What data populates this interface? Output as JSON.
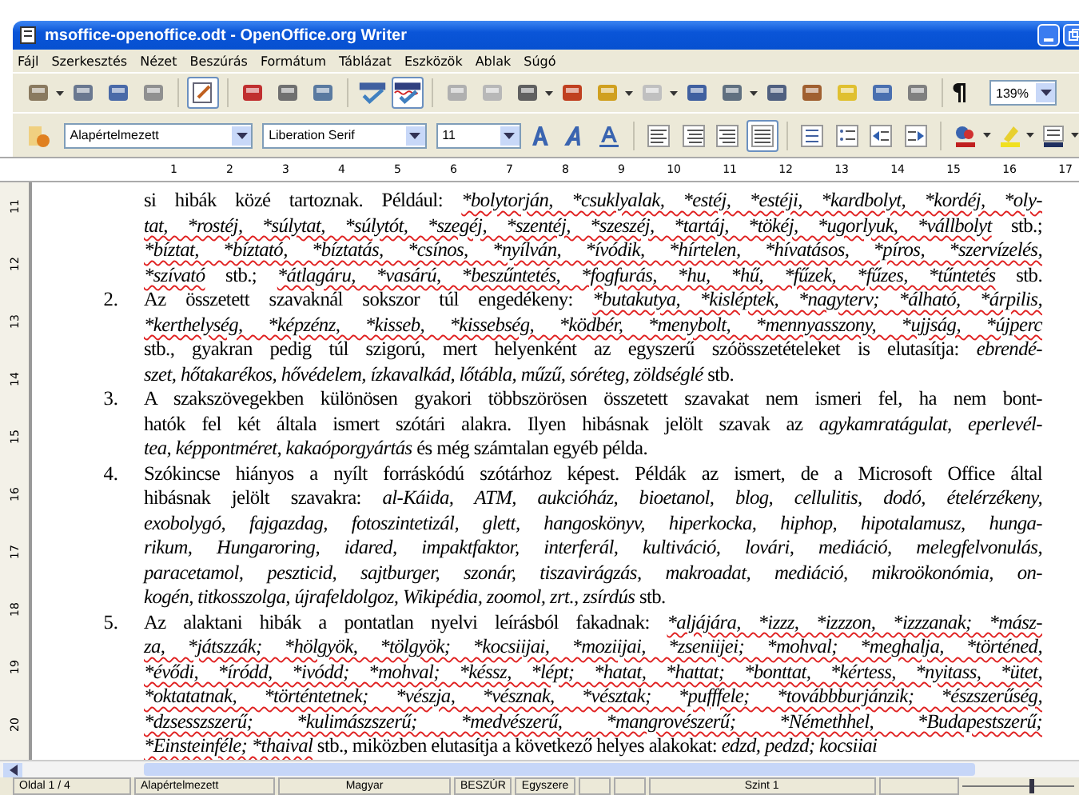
{
  "window": {
    "title": "msoffice-openoffice.odt - OpenOffice.org Writer"
  },
  "menu": [
    "Fájl",
    "Szerkesztés",
    "Nézet",
    "Beszúrás",
    "Formátum",
    "Táblázat",
    "Eszközök",
    "Ablak",
    "Súgó"
  ],
  "standard_toolbar": {
    "edit_mode_on": true,
    "auto_spellcheck_on": true,
    "zoom": "139%"
  },
  "formatting_toolbar": {
    "paragraph_style": "Alapértelmezett",
    "font": "Liberation Serif",
    "size": "11",
    "alignment": [
      {
        "selected": false
      },
      {
        "selected": false
      },
      {
        "selected": false
      },
      {
        "selected": true
      }
    ]
  },
  "ruler": {
    "marks": [
      "1",
      "2",
      "3",
      "4",
      "5",
      "6",
      "7",
      "8",
      "9",
      "10",
      "11",
      "12",
      "13",
      "14",
      "15",
      "16",
      "17"
    ]
  },
  "vertical_ruler": {
    "marks": [
      "11",
      "12",
      "13",
      "14",
      "15",
      "16",
      "17",
      "18",
      "19",
      "20"
    ]
  },
  "document": {
    "items": [
      {
        "lines": [
          [
            {
              "text": "si hibák közé tartoznak. Például: ",
              "kind": "plain"
            },
            {
              "text": "*bolytorján, *csuklyalak, *estéj, *estéji, *kardbolyt, *kordéj, *oly-",
              "kind": "flagged"
            }
          ],
          [
            {
              "text": "tat, *rostéj, *súlytat, *súlytót, *szegéj, *szentéj, *szeszéj, *tartáj, *tökéj, *ugorlyuk, *vállbolyt",
              "kind": "flagged"
            },
            {
              "text": " stb.;",
              "kind": "plain"
            }
          ],
          [
            {
              "text": "*bíztat, *bíztató, *bíztatás, *csínos, *nyílván, *ívódik, *hírtelen, *hívatásos, *píros, *szervízelés,",
              "kind": "flagged"
            }
          ],
          [
            {
              "text": "*szívató",
              "kind": "flagged"
            },
            {
              "text": " stb.; ",
              "kind": "plain"
            },
            {
              "text": "*átlagáru, *vasárú, *beszűntetés, *fogfurás, *hu, *hű, *fűzek, *fűzes, *tűntetés",
              "kind": "flagged"
            },
            {
              "text": " stb.",
              "kind": "plain"
            }
          ]
        ]
      },
      {
        "number": "2.",
        "lines": [
          [
            {
              "text": "Az összetett szavaknál sokszor túl engedékeny: ",
              "kind": "plain"
            },
            {
              "text": "*butakutya, *kisléptek, *nagyterv; *álható, *árpilis,",
              "kind": "flagged"
            }
          ],
          [
            {
              "text": "*kerthelység, *képzénz, *kisseb, *kissebség, *ködbér, *menybolt, *mennyasszony, *ujjság, *újperc",
              "kind": "flagged"
            }
          ],
          [
            {
              "text": "stb., gyakran pedig túl szigorú, mert helyenként az egyszerű szóösszetételeket is elutasítja: ",
              "kind": "plain"
            },
            {
              "text": "ebrendé-",
              "kind": "italic"
            }
          ],
          [
            {
              "text": "szet, hőtakarékos, hővédelem, ízkavalkád, lőtábla, műzű, sóréteg, zöldséglé",
              "kind": "italic"
            },
            {
              "text": " stb.",
              "kind": "plain"
            }
          ]
        ]
      },
      {
        "number": "3.",
        "lines": [
          [
            {
              "text": "A szakszövegekben különösen gyakori többszörösen összetett szavakat nem ismeri fel, ha nem bont-",
              "kind": "plain"
            }
          ],
          [
            {
              "text": "hatók fel két általa ismert szótári alakra. Ilyen hibásnak jelölt szavak az ",
              "kind": "plain"
            },
            {
              "text": "agykamratágulat, eperlevél-",
              "kind": "italic"
            }
          ],
          [
            {
              "text": "tea, képpontméret, kakaóporgyártás",
              "kind": "italic"
            },
            {
              "text": " és még számtalan egyéb példa.",
              "kind": "plain"
            }
          ]
        ]
      },
      {
        "number": "4.",
        "lines": [
          [
            {
              "text": "Szókincse hiányos a nyílt forráskódú szótárhoz képest. Példák az ismert, de a Microsoft Office által",
              "kind": "plain"
            }
          ],
          [
            {
              "text": "hibásnak jelölt szavakra: ",
              "kind": "plain"
            },
            {
              "text": "al-Káida, ATM, aukcióház, bioetanol, blog, cellulitis, dodó, ételérzékeny,",
              "kind": "italic"
            }
          ],
          [
            {
              "text": "exobolygó, fajgazdag, fotoszintetizál, glett, hangoskönyv, hiperkocka, hiphop, hipotalamusz, hunga-",
              "kind": "italic"
            }
          ],
          [
            {
              "text": "rikum, Hungaroring, idared, impaktfaktor, interferál, kultiváció, lovári, mediáció, melegfelvonulás,",
              "kind": "italic"
            }
          ],
          [
            {
              "text": "paracetamol, peszticid, sajtburger, szonár, tiszavirágzás, makroadat, mediáció, mikroökonómia, on-",
              "kind": "italic"
            }
          ],
          [
            {
              "text": "kogén, titkosszolga, újrafeldolgoz, Wikipédia, zoomol, zrt., zsírdús",
              "kind": "italic"
            },
            {
              "text": " stb.",
              "kind": "plain"
            }
          ]
        ]
      },
      {
        "number": "5.",
        "lines": [
          [
            {
              "text": "Az alaktani hibák a pontatlan nyelvi leírásból fakadnak: ",
              "kind": "plain"
            },
            {
              "text": "*aljájára, *izzz, *izzzon, *izzzanak; *mász-",
              "kind": "flagged"
            }
          ],
          [
            {
              "text": "za, *játszzák; *hölgyök, *tölgyök; *kocsiijai, *moziijai, *zseniijei; *mohval; *meghalja, *történed,",
              "kind": "flagged"
            }
          ],
          [
            {
              "text": "*évődi, *íródd, *ivódd; *mohval; *késsz, *lépt; *hatat, *hattat; *bonttat, *kértess, *nyitass, *ütet,",
              "kind": "flagged"
            }
          ],
          [
            {
              "text": "*oktatatnak, *történtetnek; *vészja, *vésznak, *vésztak; *pufffele; *továbbburjánzik; *észszerűség,",
              "kind": "flagged"
            }
          ],
          [
            {
              "text": "*dzsesszszerű; *kulimászszerű; *medvészerű, *mangrovészerű; *Némethhel, *Budapestszerű;",
              "kind": "flagged"
            }
          ],
          [
            {
              "text": "*Einsteinféle; *thaival",
              "kind": "flagged"
            },
            {
              "text": " stb., miközben elutasítja a következő helyes alakokat: ",
              "kind": "plain"
            },
            {
              "text": "edzd, pedzd; kocsiiai",
              "kind": "italic"
            }
          ]
        ]
      }
    ]
  },
  "status_bar": {
    "page": "Oldal 1 / 4",
    "style": "Alapértelmezett",
    "language": "Magyar",
    "insert_mode": "BESZÚR",
    "selection_mode": "Egyszere",
    "outline_level": "Szint 1",
    "zoom_slider": {
      "level": 0.6
    }
  }
}
